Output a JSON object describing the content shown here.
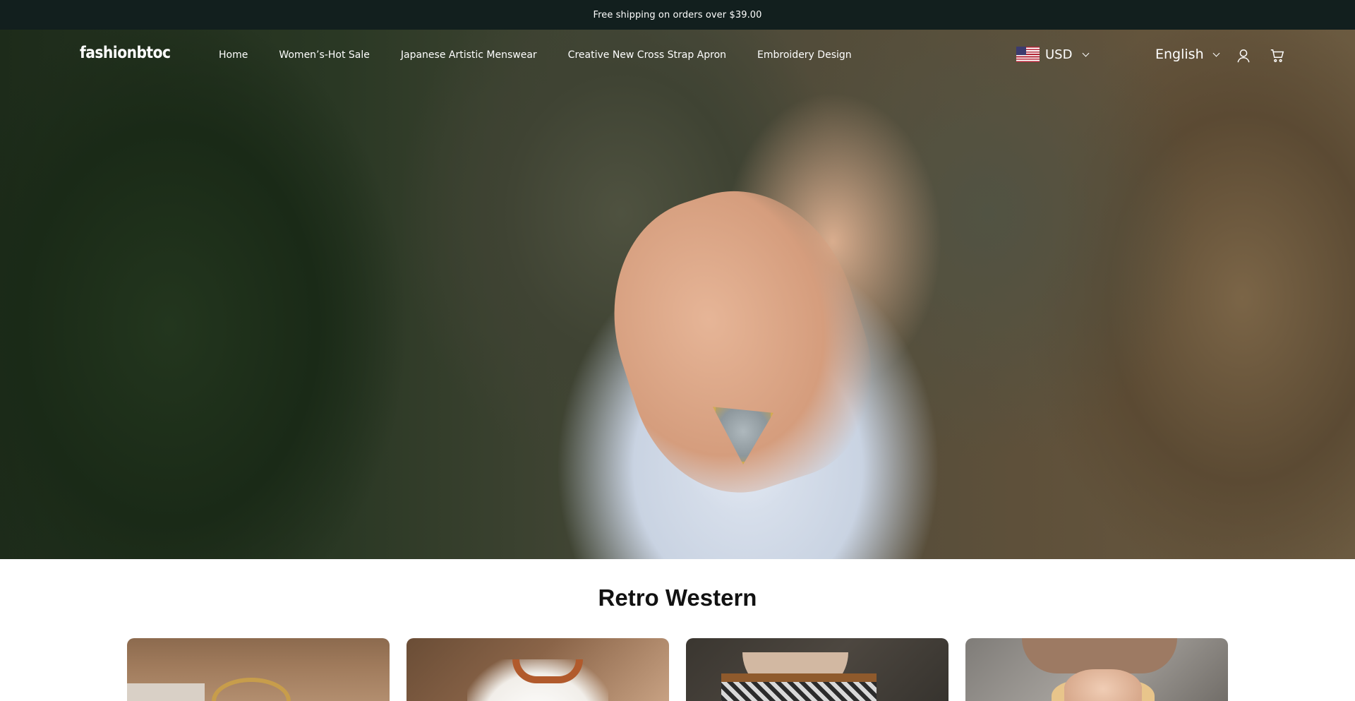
{
  "announcement": {
    "text": "Free shipping on orders over $39.00"
  },
  "header": {
    "logo": "fashionbtoc",
    "nav": [
      {
        "label": "Home"
      },
      {
        "label": "Women’s-Hot Sale"
      },
      {
        "label": "Japanese Artistic Menswear"
      },
      {
        "label": "Creative New Cross Strap Apron"
      },
      {
        "label": "Embroidery Design"
      }
    ],
    "currency": {
      "label": "USD",
      "flag": "us-flag"
    },
    "language": {
      "label": "English"
    },
    "icons": {
      "account": "user-icon",
      "cart": "cart-icon"
    }
  },
  "hero": {
    "image": "woman-hands-with-rings"
  },
  "section": {
    "title": "Retro Western",
    "cards": [
      {
        "image": "wooden-hanger-on-wood-wall"
      },
      {
        "image": "woman-raglan-tee"
      },
      {
        "image": "man-western-jacket"
      },
      {
        "image": "woman-cowboy-hat"
      }
    ]
  },
  "colors": {
    "announcement_bg": "#121f1e",
    "header_text": "#ffffff",
    "title_text": "#121212"
  }
}
